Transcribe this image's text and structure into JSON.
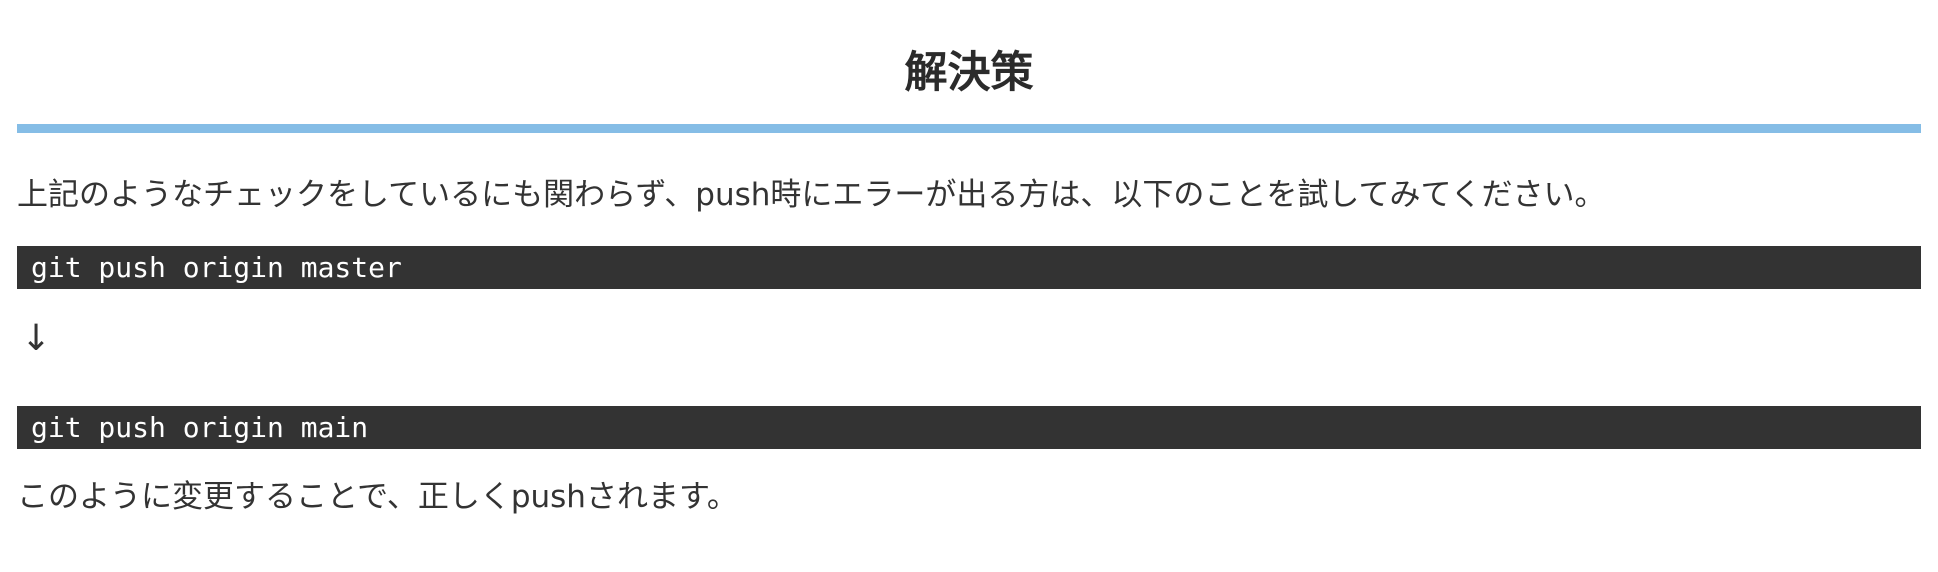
{
  "section": {
    "heading": "解決策",
    "intro_text": "上記のようなチェックをしているにも関わらず、push時にエラーが出る方は、以下のことを試してみてください。",
    "code_before": "git push origin master",
    "arrow": "↓",
    "code_after": "git push origin main",
    "conclusion_text": "このように変更することで、正しくpushされます。"
  },
  "colors": {
    "heading_rule": "#85bde6",
    "code_background": "#333333",
    "code_text": "#ffffff",
    "body_text": "#333333"
  }
}
